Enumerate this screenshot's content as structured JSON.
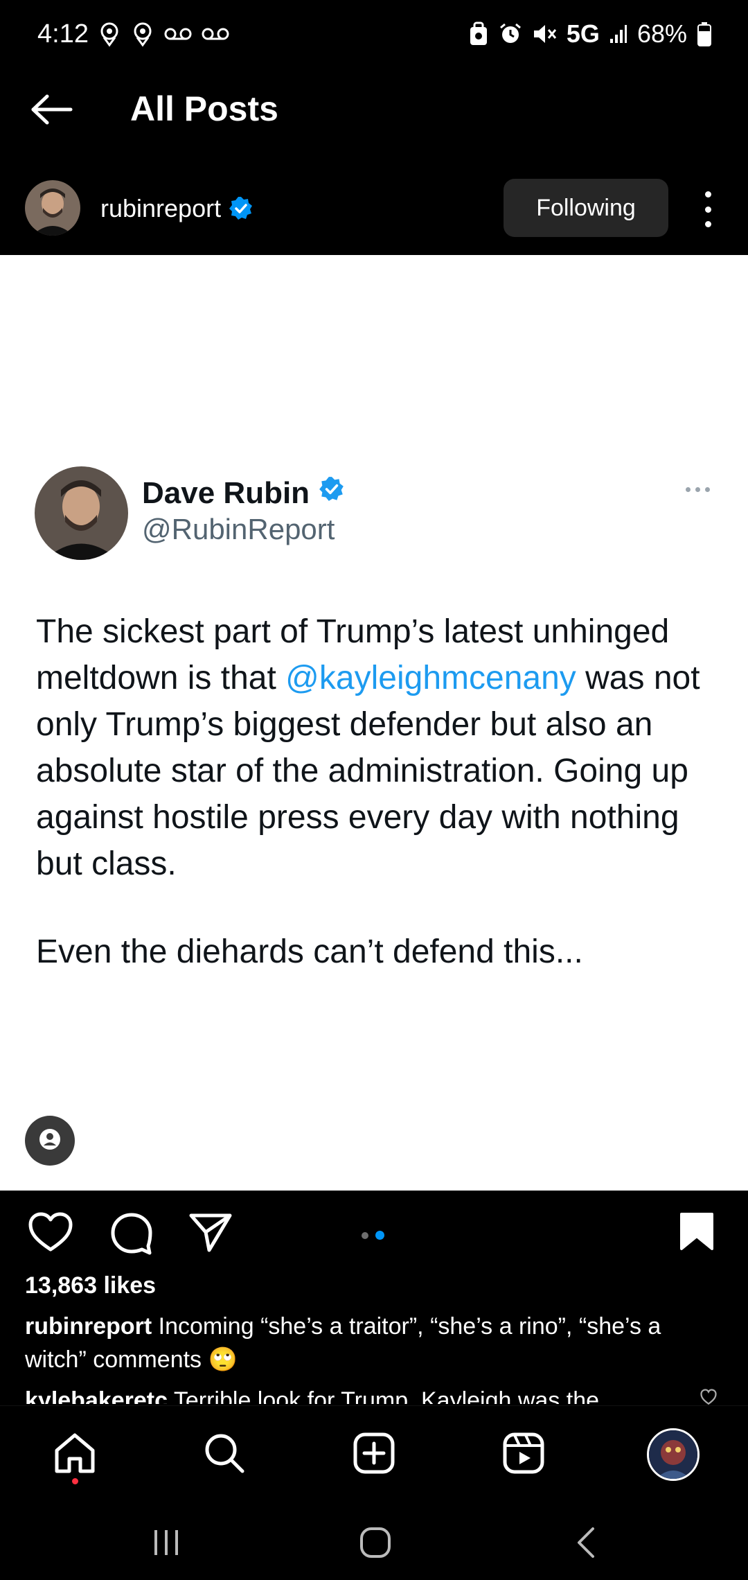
{
  "status_bar": {
    "time": "4:12",
    "network": "5G",
    "battery": "68%"
  },
  "header": {
    "title": "All Posts",
    "back_icon": "arrow-left-icon"
  },
  "post": {
    "username": "rubinreport",
    "follow_label": "Following",
    "tweet": {
      "name": "Dave Rubin",
      "handle": "@RubinReport",
      "text_before": "The sickest part of Trump’s latest unhinged meltdown is that ",
      "mention": "@kayleighmcenany",
      "text_after": " was not only Trump’s biggest defender but also an absolute star of the administration. Going up against hostile press every day with nothing but class.",
      "text_para2": "Even the diehards can’t defend this..."
    },
    "likes": "13,863 likes",
    "caption_user": "rubinreport",
    "caption_text": " Incoming “she’s a traitor”, “she’s a rino”, “she’s a witch” comments 🙄",
    "comment_preview_user": "kylebakeretc",
    "comment_preview_text": " Terrible look for Trump. Kayleigh was the",
    "carousel": {
      "count": 2,
      "active_index": 1
    }
  },
  "colors": {
    "accent_blue": "#0095f6",
    "verified_blue": "#1d9bf0",
    "notification_red": "#ff3040"
  }
}
